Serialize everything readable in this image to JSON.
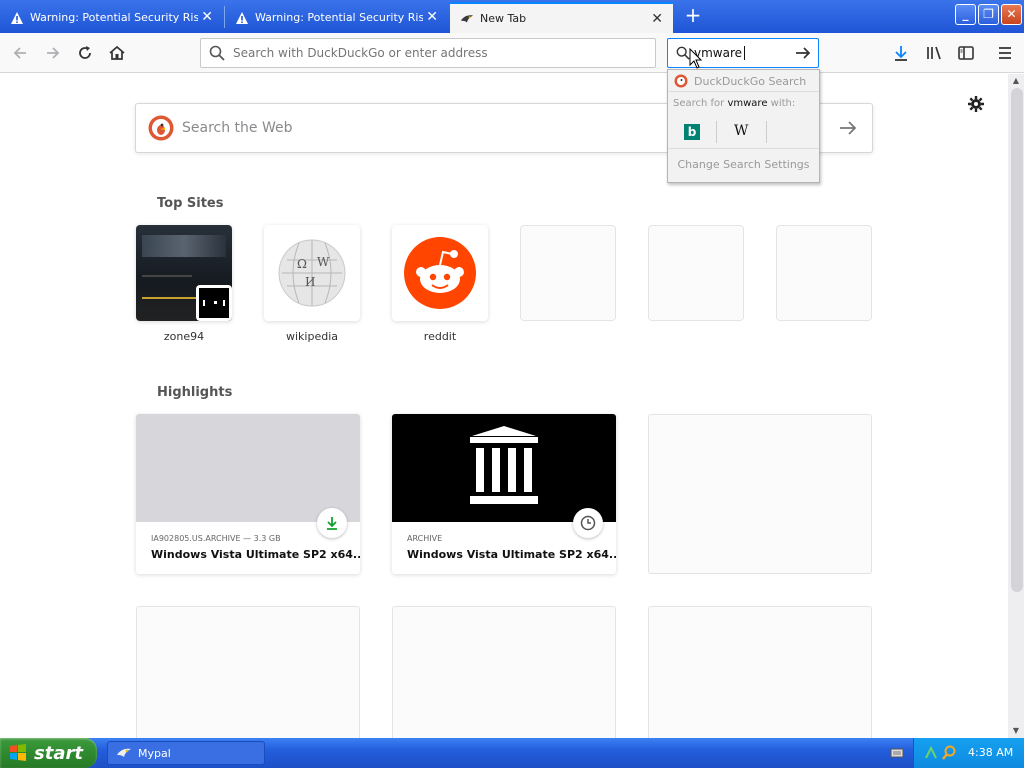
{
  "tabs": [
    {
      "title": "Warning: Potential Security Risk A",
      "icon": "warning-icon",
      "active": false
    },
    {
      "title": "Warning: Potential Security Risk A",
      "icon": "warning-icon",
      "active": false
    },
    {
      "title": "New Tab",
      "icon": "mypal-favicon",
      "active": true
    }
  ],
  "window_controls": {
    "minimize": "_",
    "maximize": "❐",
    "close": "✕"
  },
  "navbar": {
    "url_placeholder": "Search with DuckDuckGo or enter address",
    "search_value": "vmware"
  },
  "search_dropdown": {
    "engine_title": "DuckDuckGo Search",
    "search_for_prefix": "Search for ",
    "search_term": "vmware",
    "search_for_suffix": " with:",
    "engines": [
      "bing-icon",
      "wikipedia-icon"
    ],
    "change_settings": "Change Search Settings"
  },
  "newtab": {
    "search_placeholder": "Search the Web",
    "top_sites_heading": "Top Sites",
    "top_sites": [
      {
        "label": "zone94"
      },
      {
        "label": "wikipedia"
      },
      {
        "label": "reddit"
      },
      {
        "label": ""
      },
      {
        "label": ""
      },
      {
        "label": ""
      }
    ],
    "highlights_heading": "Highlights",
    "highlights": [
      {
        "source": "IA902805.US.ARCHIVE — 3.3 GB",
        "title": "Windows Vista Ultimate SP2 x64...",
        "badge": "download-icon"
      },
      {
        "source": "ARCHIVE",
        "title": "Windows Vista Ultimate SP2 x64...",
        "badge": "clock-icon"
      }
    ]
  },
  "taskbar": {
    "start_label": "start",
    "task_label": "Mypal",
    "clock": "4:38 AM"
  },
  "colors": {
    "accent": "#0a84ff",
    "xp_taskbar": "#245edb",
    "xp_start": "#2f8a2f",
    "reddit": "#ff4500"
  }
}
